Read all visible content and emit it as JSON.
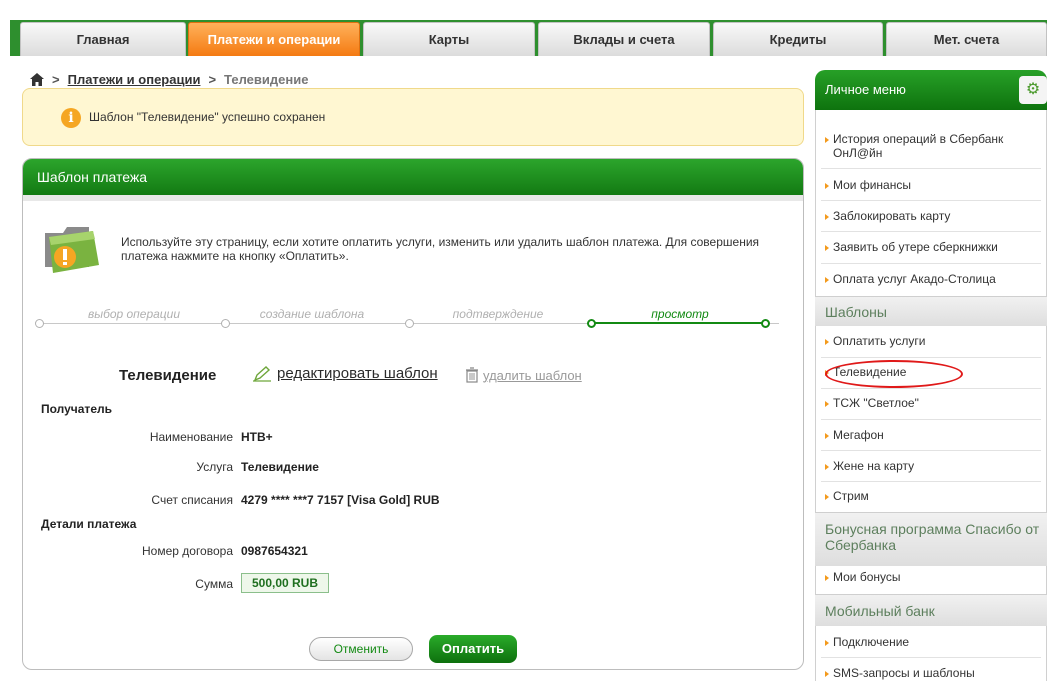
{
  "nav": {
    "tabs": [
      {
        "label": "Главная"
      },
      {
        "label": "Платежи и операции"
      },
      {
        "label": "Карты"
      },
      {
        "label": "Вклады и счета"
      },
      {
        "label": "Кредиты"
      },
      {
        "label": "Мет. счета"
      }
    ],
    "active_tab": "Платежи и операции"
  },
  "breadcrumb": {
    "link": "Платежи и операции",
    "current": "Телевидение"
  },
  "message": {
    "text": "Шаблон \"Телевидение\" успешно сохранен"
  },
  "panel": {
    "title": "Шаблон платежа",
    "intro": "Используйте эту страницу, если хотите оплатить услуги, изменить или удалить шаблон платежа. Для совершения платежа нажмите на кнопку «Оплатить».",
    "steps": [
      {
        "label": "выбор операции"
      },
      {
        "label": "создание шаблона"
      },
      {
        "label": "подтверждение"
      },
      {
        "label": "просмотр"
      }
    ],
    "template_name": "Телевидение",
    "edit_label": "редактировать шаблон",
    "delete_label": "удалить шаблон",
    "recipient_header": "Получатель",
    "recipient": {
      "name_label": "Наименование",
      "name_value": "НТВ+",
      "service_label": "Услуга",
      "service_value": "Телевидение",
      "account_label": "Счет списания",
      "account_value": "4279 **** ***7 7157  [Visa Gold]  RUB"
    },
    "details_header": "Детали платежа",
    "details": {
      "contract_label": "Номер договора",
      "contract_value": "0987654321",
      "amount_label": "Сумма",
      "amount_value": "500,00 RUB"
    },
    "cancel_label": "Отменить",
    "pay_label": "Оплатить"
  },
  "sidebar": {
    "personal_menu_title": "Личное меню",
    "personal_items": [
      {
        "label": "История операций в Сбербанк ОнЛ@йн"
      },
      {
        "label": "Мои финансы"
      },
      {
        "label": "Заблокировать карту"
      },
      {
        "label": "Заявить об утере сберкнижки"
      },
      {
        "label": "Оплата услуг Акадо-Столица"
      }
    ],
    "templates_title": "Шаблоны",
    "template_items": [
      {
        "label": "Оплатить услуги"
      },
      {
        "label": "Телевидение"
      },
      {
        "label": "ТСЖ \"Светлое\""
      },
      {
        "label": "Мегафон"
      },
      {
        "label": "Жене на карту"
      },
      {
        "label": "Стрим"
      }
    ],
    "bonus_title": "Бонусная программа Спасибо от Сбербанка",
    "bonus_items": [
      {
        "label": "Мои бонусы"
      }
    ],
    "mobile_title": "Мобильный банк",
    "mobile_items": [
      {
        "label": "Подключение"
      },
      {
        "label": "SMS-запросы и шаблоны"
      }
    ]
  },
  "colors": {
    "brand_green": "#138a13",
    "active_tab_orange": "#f47a12",
    "highlight_red": "#e01919"
  }
}
